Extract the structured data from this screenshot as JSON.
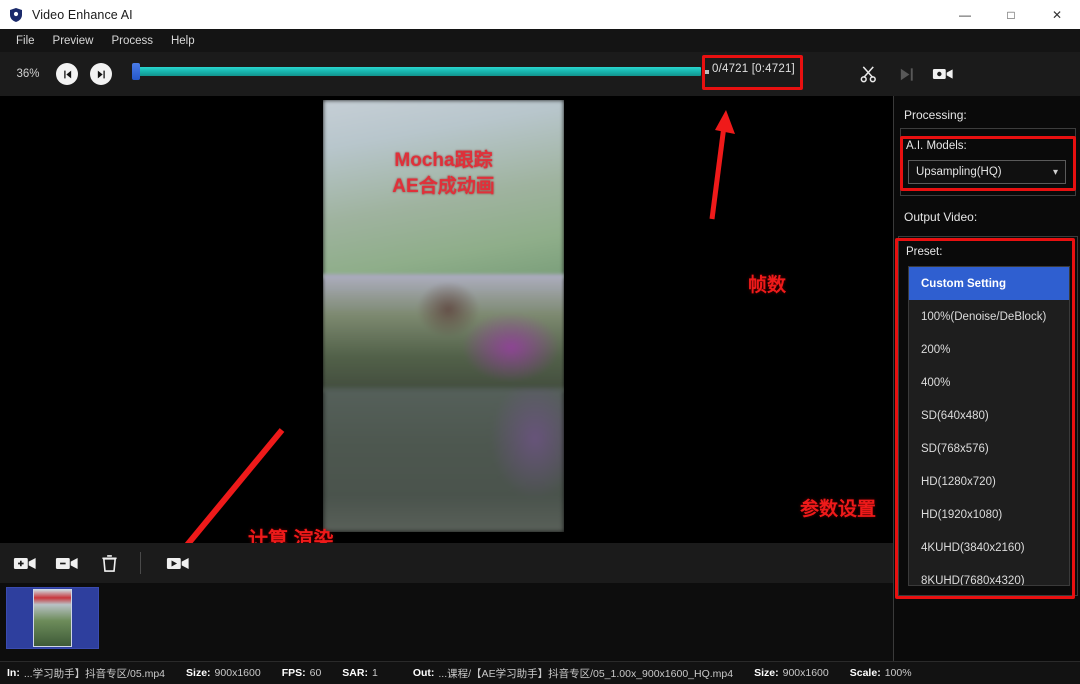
{
  "window": {
    "title": "Video Enhance AI",
    "icon": "shield-icon",
    "minimize": "—",
    "maximize": "□",
    "close": "✕"
  },
  "menubar": {
    "items": [
      {
        "label": "File",
        "name": "menu-file"
      },
      {
        "label": "Preview",
        "name": "menu-preview"
      },
      {
        "label": "Process",
        "name": "menu-process"
      },
      {
        "label": "Help",
        "name": "menu-help"
      }
    ]
  },
  "toolbar": {
    "zoom_level": "36%",
    "prev_frame_icon": "skip-back-icon",
    "next_frame_icon": "skip-forward-icon",
    "frame_counter": "0/4721  [0:4721]",
    "slider_value": 0,
    "slider_max": 4721,
    "cut_icon": "scissors-icon",
    "cut_disabled_icon": "trim-icon",
    "camera_icon": "video-camera-icon"
  },
  "preview": {
    "overlay_line1": "Mocha跟踪",
    "overlay_line2": "AE合成动画",
    "overlay_color": "#e0303a"
  },
  "annotations": {
    "color": "#ef1a1a",
    "frames": "帧数",
    "params": "参数设置",
    "render": "计算 渲染"
  },
  "bottom_toolbar": {
    "add_video_icon": "add-video-icon",
    "remove_video_icon": "remove-video-icon",
    "delete_icon": "trash-icon",
    "render_icon": "render-video-icon"
  },
  "filmstrip": {
    "selected_index": 0,
    "thumbnails": [
      {
        "name": "video-thumbnail"
      }
    ]
  },
  "panel": {
    "processing_label": "Processing:",
    "ai_models_label": "A.I. Models:",
    "ai_model_selected": "Upsampling(HQ)",
    "ai_model_arrow": "chevron-down-icon",
    "output_video_label": "Output Video:",
    "preset_label": "Preset:",
    "preset_selected": "Custom Setting",
    "preset_options": [
      "Custom Setting",
      "100%(Denoise/DeBlock)",
      "200%",
      "400%",
      "SD(640x480)",
      "SD(768x576)",
      "HD(1280x720)",
      "HD(1920x1080)",
      "4KUHD(3840x2160)",
      "8KUHD(7680x4320)"
    ]
  },
  "statusbar": {
    "in_key": "In:",
    "in_value": "...学习助手】抖音专区/05.mp4",
    "in_size_key": "Size:",
    "in_size_value": "900x1600",
    "fps_key": "FPS:",
    "fps_value": "60",
    "sar_key": "SAR:",
    "sar_value": "1",
    "out_key": "Out:",
    "out_value": "...课程/【AE学习助手】抖音专区/05_1.00x_900x1600_HQ.mp4",
    "out_size_key": "Size:",
    "out_size_value": "900x1600",
    "scale_key": "Scale:",
    "scale_value": "100%"
  }
}
